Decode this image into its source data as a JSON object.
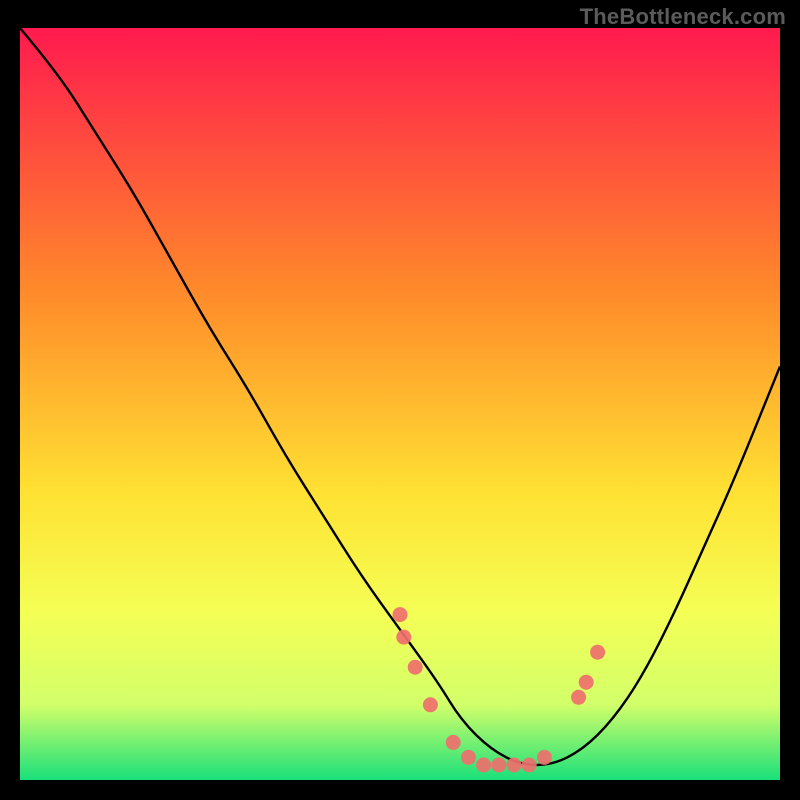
{
  "watermark": "TheBottleneck.com",
  "chart_data": {
    "type": "line",
    "title": "",
    "xlabel": "",
    "ylabel": "",
    "xlim": [
      0,
      100
    ],
    "ylim": [
      0,
      100
    ],
    "grid": false,
    "legend": false,
    "background_gradient": {
      "top": "#ff1a4e",
      "mid1": "#ff8a2a",
      "mid2": "#ffe233",
      "mid3": "#f4ff55",
      "mid4": "#d2ff6a",
      "bottom": "#19e07a"
    },
    "series": [
      {
        "name": "curve",
        "type": "line",
        "x": [
          0,
          5,
          10,
          15,
          20,
          25,
          30,
          35,
          40,
          45,
          50,
          55,
          58,
          62,
          66,
          70,
          74,
          78,
          82,
          86,
          90,
          94,
          100
        ],
        "y": [
          100,
          94,
          86,
          78,
          69,
          60,
          52,
          43,
          35,
          27,
          20,
          13,
          8,
          4,
          2,
          2,
          4,
          8,
          14,
          22,
          31,
          40,
          55
        ]
      },
      {
        "name": "points",
        "type": "scatter",
        "x": [
          50,
          50.5,
          52,
          54,
          57,
          59,
          61,
          63,
          65,
          67,
          69,
          73.5,
          74.5,
          76
        ],
        "y": [
          22,
          19,
          15,
          10,
          5,
          3,
          2,
          2,
          2,
          2,
          3,
          11,
          13,
          17
        ]
      }
    ]
  }
}
